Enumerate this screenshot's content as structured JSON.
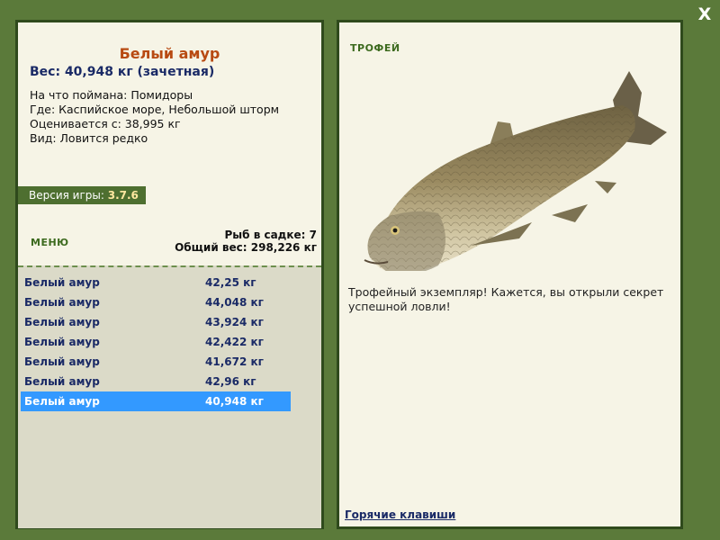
{
  "window": {
    "close_label": "X"
  },
  "catch": {
    "title": "Белый амур",
    "weight": "Вес: 40,948 кг (зачетная)",
    "bait": "На что поймана: Помидоры",
    "place": "Где: Каспийское море, Небольшой шторм",
    "value": "Оценивается с: 38,995 кг",
    "rarity": "Вид: Ловится редко"
  },
  "version": {
    "label": "Версия игры:",
    "number": "3.7.6"
  },
  "menu": {
    "label": "МЕНЮ"
  },
  "cage": {
    "count": "Рыб в садке: 7",
    "total": "Общий вес: 298,226 кг"
  },
  "fish_list": [
    {
      "name": "Белый амур",
      "weight": "42,25 кг"
    },
    {
      "name": "Белый амур",
      "weight": "44,048 кг"
    },
    {
      "name": "Белый амур",
      "weight": "43,924 кг"
    },
    {
      "name": "Белый амур",
      "weight": "42,422 кг"
    },
    {
      "name": "Белый амур",
      "weight": "41,672 кг"
    },
    {
      "name": "Белый амур",
      "weight": "42,96 кг"
    },
    {
      "name": "Белый амур",
      "weight": "40,948 кг"
    }
  ],
  "selected_index": 6,
  "trophy": {
    "label": "ТРОФЕЙ",
    "text": "Трофейный экземпляр! Кажется, вы открыли секрет успешной ловли!"
  },
  "hotkeys": {
    "label": "Горячие клавиши"
  },
  "colors": {
    "frame": "#5b7a3a",
    "panel": "#f6f4e6",
    "list_bg": "#dbdac8",
    "selection": "#3399ff",
    "title": "#b84a12"
  }
}
